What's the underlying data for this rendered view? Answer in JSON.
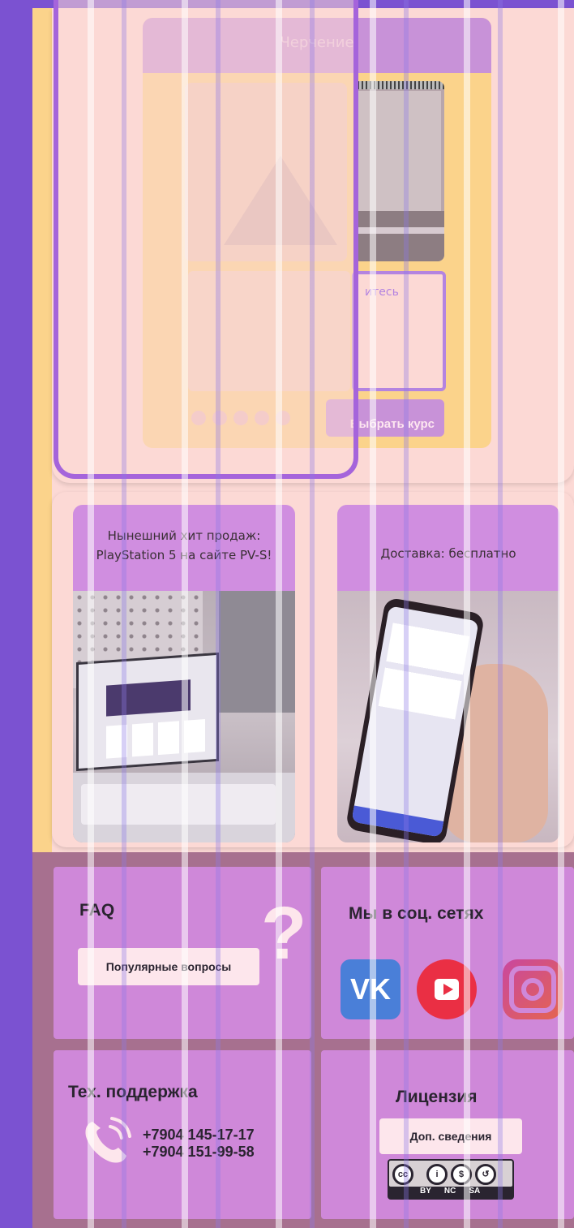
{
  "course_card": {
    "title": "Черчение",
    "description_text": "итесь",
    "choose_button": "Выбрать курс"
  },
  "promos": [
    {
      "title_line1": "Нынешний хит продаж:",
      "title_line2": "PlayStation 5 на сайте PV-S!"
    },
    {
      "title_line1": "Доставка: бесплатно",
      "title_line2": ""
    }
  ],
  "footer": {
    "faq": {
      "title": "FAQ",
      "button": "Популярные вопросы",
      "icon": "question-icon"
    },
    "social": {
      "title": "Мы в соц. сетях",
      "vk_label": "VK",
      "icons": [
        "vk-icon",
        "youtube-icon",
        "instagram-icon"
      ]
    },
    "support": {
      "title": "Тех. поддержка",
      "phone1": "+7904 145-17-17",
      "phone2": "+7904 151-99-58",
      "icon": "phone-icon"
    },
    "license": {
      "title": "Лицензия",
      "button": "Доп. сведения",
      "cc_by": "BY",
      "cc_nc": "NC",
      "cc_sa": "SA",
      "cc": "cc"
    }
  },
  "colors": {
    "purple": "#7b52d1",
    "tile": "#cf88d9",
    "pink_bg": "#fcd9d5",
    "yellow": "#fbd38b"
  }
}
